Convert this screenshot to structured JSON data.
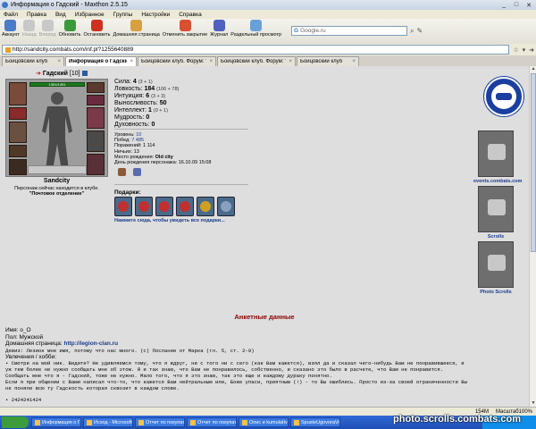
{
  "window": {
    "title": "Информация о Гадский - Maxthon 2.5.15"
  },
  "menu": [
    "Файл",
    "Правка",
    "Вид",
    "Избранное",
    "Группы",
    "Настройки",
    "Справка"
  ],
  "toolbar": {
    "buttons": [
      {
        "label": "Аккаунт",
        "icon": "account-icon",
        "color": "#4a7cc8",
        "disabled": false
      },
      {
        "label": "Назад",
        "icon": "back-arrow-icon",
        "color": "#c8c8c8",
        "disabled": true
      },
      {
        "label": "Вперед",
        "icon": "forward-arrow-icon",
        "color": "#c8c8c8",
        "disabled": true
      },
      {
        "label": "Обновить",
        "icon": "refresh-icon",
        "color": "#3a9a3a",
        "disabled": false
      },
      {
        "label": "Остановить",
        "icon": "stop-icon",
        "color": "#d03020",
        "disabled": false
      },
      {
        "label": "Домашняя страница",
        "icon": "home-icon",
        "color": "#d8a040",
        "disabled": false
      },
      {
        "label": "Отменить закрытие",
        "icon": "undo-close-icon",
        "color": "#d85030",
        "disabled": false
      },
      {
        "label": "Журнал",
        "icon": "history-icon",
        "color": "#5060c0",
        "disabled": false
      },
      {
        "label": "Раздельный просмотр",
        "icon": "split-view-icon",
        "color": "#6aa0d8",
        "disabled": false
      }
    ],
    "search_placeholder": "Google.ru"
  },
  "address": {
    "url": "http://sandcity.combats.com/inf.pl?1255640889"
  },
  "tabs": [
    {
      "label": "Бойцовский клуб",
      "active": false
    },
    {
      "label": "Информация о Гадский",
      "active": true
    },
    {
      "label": "Бойцовский клуб. Форум: \"Б...",
      "active": false
    },
    {
      "label": "Бойцовский клуб. Форум: \"П...",
      "active": false
    },
    {
      "label": "Бойцовский клуб",
      "active": false
    }
  ],
  "character": {
    "arrow": "➔",
    "name": "Гадский",
    "level": "[10]",
    "hp": "1351/1351",
    "owner": "Sandcity",
    "status_line1": "Персонаж сейчас находится в клубе.",
    "status_line2": "\"Почтовое отделение\""
  },
  "stats": [
    {
      "label": "Сила:",
      "value": "4",
      "mod": "(3 + 1)"
    },
    {
      "label": "Ловкость:",
      "value": "184",
      "mod": "(106 + 78)"
    },
    {
      "label": "Интуиция:",
      "value": "6",
      "mod": "(3 + 3)"
    },
    {
      "label": "Выносливость:",
      "value": "50",
      "mod": ""
    },
    {
      "label": "Интеллект:",
      "value": "1",
      "mod": "(0 + 1)"
    },
    {
      "label": "Мудрость:",
      "value": "0",
      "mod": ""
    },
    {
      "label": "Духовность:",
      "value": "0",
      "mod": ""
    }
  ],
  "info": {
    "level_label": "Уровень:",
    "level_value": "10",
    "wins_label": "Побед:",
    "wins_value": "7 485",
    "losses_label": "Поражений:",
    "losses_value": "1 114",
    "draws_label": "Ничьих:",
    "draws_value": "13",
    "birthplace_label": "Место рождения:",
    "birthplace_value": "Old city",
    "birthday_label": "День рождения персонажа:",
    "birthday_value": "16.10.09 15:08"
  },
  "gifts": {
    "title": "Подарки:",
    "link": "Нажмите сюда, чтобы увидеть все подарки...",
    "items": [
      {
        "icon": "gift-heart-icon",
        "color": "#c03030"
      },
      {
        "icon": "gift-heart-icon",
        "color": "#c03030"
      },
      {
        "icon": "gift-heart-icon",
        "color": "#c03030"
      },
      {
        "icon": "gift-heart-icon",
        "color": "#c03030"
      },
      {
        "icon": "gift-book-icon",
        "color": "#d0a020"
      },
      {
        "icon": "gift-badge-icon",
        "color": "#8aa0c0"
      }
    ]
  },
  "sidebar": {
    "events_label": "events.combats.com",
    "scrolls_label": "Scrolls",
    "photo_scrolls_label": "Photo Scrolls"
  },
  "profile": {
    "section_title": "Анкетные данные",
    "name": "Имя: o_O",
    "gender": "Пол: Мужской",
    "homepage_label": "Домашняя страница:",
    "homepage_url": "http://legion-clan.ru",
    "motto": "Девиз: Лезиок мне имя, потому что нас много. (c) Послание от Марка (гл. 5, ст. 2-9)",
    "hobbies_label": "Увлечения / хобби:",
    "hobbies_line1": "• Смотри на мой ник. Видите? Не удивляемся тому, что я вдруг, ни с того ни с сего (как Вам кажется), взял да и сказал чего-нибудь Вам не понравившееся, и",
    "hobbies_line2": "уж тем более не нужно сообщать мне об этом. Я и так знаю, что Вам не понравилось, собственно, и сказано это было в расчете, что Вам не понравится.",
    "hobbies_line3": "Сообщать мне что я - Гадский, тоже не нужно. Мало того, что я это знаю, так это еще и каждому дураку понятно.",
    "hobbies_line4": "Если я при общении с Вами написал что-то, что кажется Вам нейтральным или, Боже упаси, приятным (!) - то Вы ошиблись. Просто из-за своей ограниченности Вы",
    "hobbies_line5": "не поняли всю ту Гадскость которая сквозит в каждом слове.",
    "cut_line": "• 2424241424"
  },
  "statusbar": {
    "memory": "154M",
    "zoom": "Масштаб100%"
  },
  "taskbar": [
    {
      "label": "Информация о Гад..."
    },
    {
      "label": "Исход - Microsoft Ou..."
    },
    {
      "label": "Отчет по покупател..."
    },
    {
      "label": "Отчет по покупател..."
    },
    {
      "label": "Опис и kumulatívni..."
    },
    {
      "label": "SpusteUgovoraVredn..."
    }
  ],
  "watermark": "photo.scrolls.combats.com"
}
